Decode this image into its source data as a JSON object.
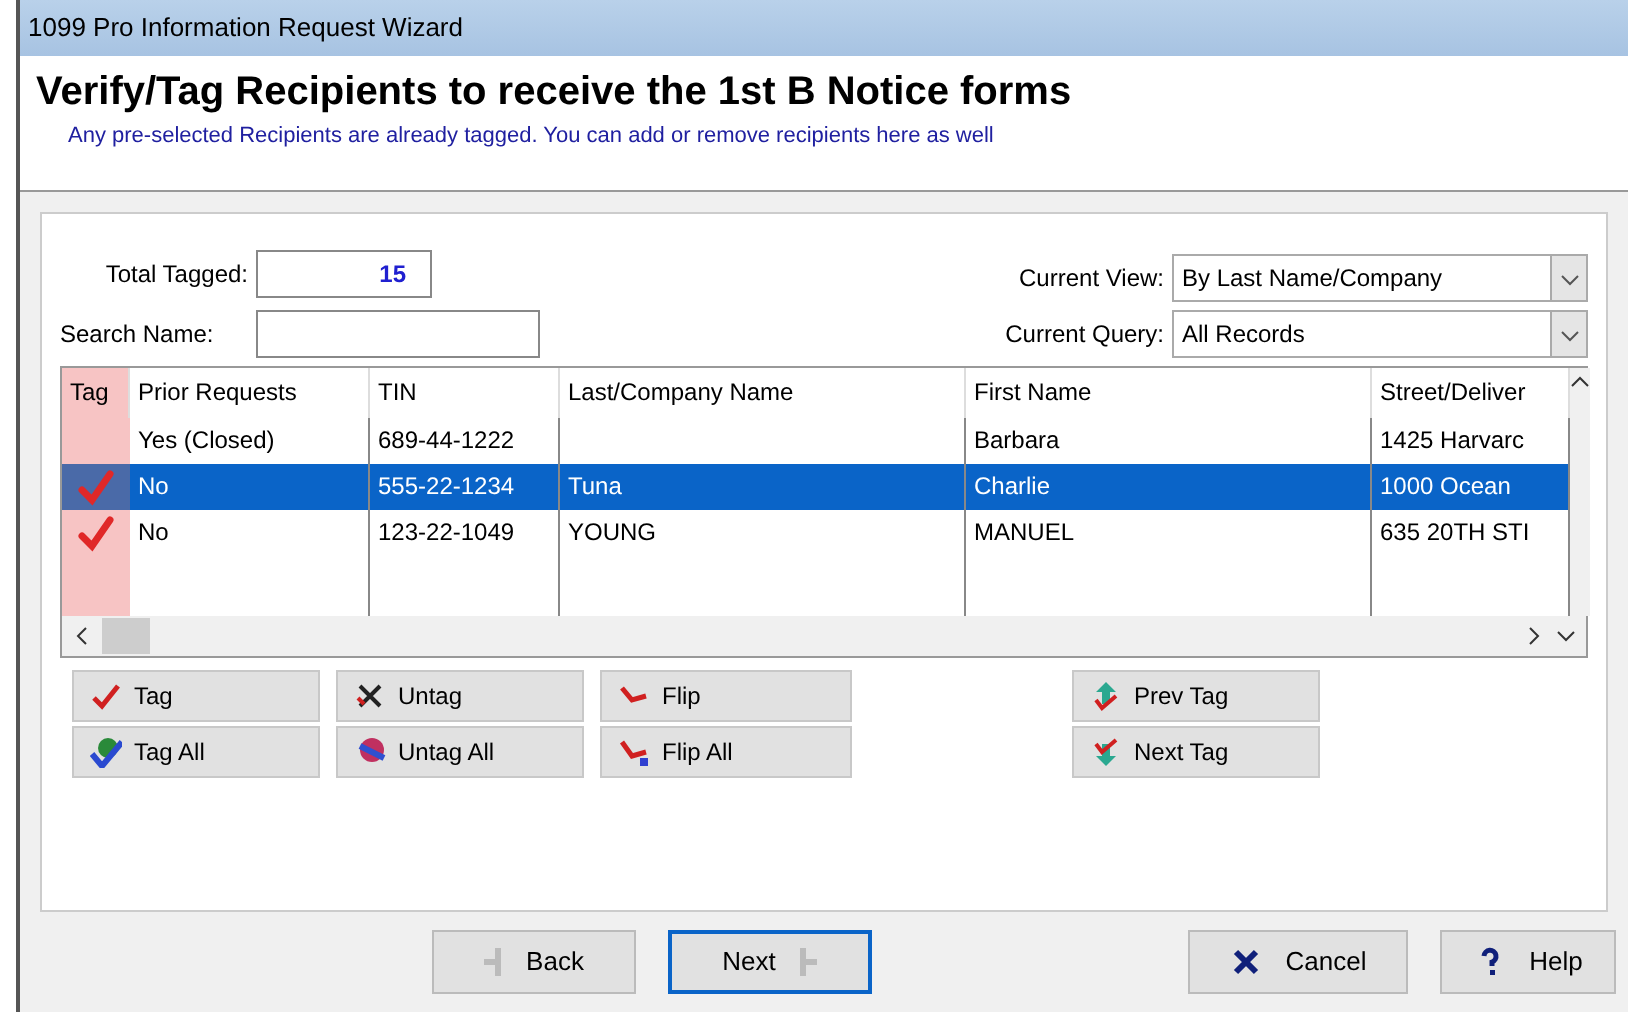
{
  "window": {
    "title": "1099 Pro Information Request Wizard"
  },
  "header": {
    "title": "Verify/Tag Recipients to receive the 1st B Notice forms",
    "subtitle": "Any pre-selected Recipients are already tagged.  You can add or remove recipients here as well"
  },
  "total_tagged": {
    "label": "Total Tagged:",
    "value": "15"
  },
  "search": {
    "label": "Search Name:"
  },
  "current_view": {
    "label": "Current View:",
    "value": "By Last Name/Company"
  },
  "current_query": {
    "label": "Current Query:",
    "value": "All Records"
  },
  "table": {
    "columns": [
      "Tag",
      "Prior Requests",
      "TIN",
      "Last/Company Name",
      "First Name",
      "Street/Deliver"
    ],
    "rows": [
      {
        "tagged": false,
        "selected": false,
        "cells": [
          "",
          "Yes (Closed)",
          "689-44-1222",
          "",
          "Barbara",
          "1425 Harvarc"
        ]
      },
      {
        "tagged": true,
        "selected": true,
        "cells": [
          "",
          "No",
          "555-22-1234",
          "Tuna",
          "Charlie",
          "1000 Ocean"
        ]
      },
      {
        "tagged": true,
        "selected": false,
        "cells": [
          "",
          "No",
          "123-22-1049",
          "YOUNG",
          "MANUEL",
          "635 20TH STI"
        ]
      }
    ]
  },
  "tag_buttons": [
    {
      "kind": "tag",
      "label": "Tag"
    },
    {
      "kind": "untag",
      "label": "Untag"
    },
    {
      "kind": "flip",
      "label": "Flip"
    },
    {
      "kind": "prev",
      "label": "Prev Tag"
    },
    {
      "kind": "tagall",
      "label": "Tag All"
    },
    {
      "kind": "untagall",
      "label": "Untag All"
    },
    {
      "kind": "flipall",
      "label": "Flip All"
    },
    {
      "kind": "next",
      "label": "Next Tag"
    }
  ],
  "footer_buttons": [
    {
      "kind": "back",
      "label": "Back",
      "selected": false
    },
    {
      "kind": "next",
      "label": "Next",
      "selected": true
    },
    {
      "kind": "cancel",
      "label": "Cancel",
      "selected": false
    },
    {
      "kind": "help",
      "label": "Help",
      "selected": false
    }
  ]
}
